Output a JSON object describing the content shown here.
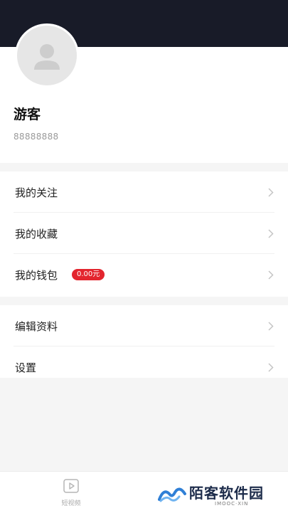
{
  "profile": {
    "name": "游客",
    "id": "88888888",
    "avatar_icon": "user-placeholder-icon"
  },
  "menu_groups": [
    {
      "items": [
        {
          "label": "我的关注",
          "icon": "chevron-right-icon"
        },
        {
          "label": "我的收藏",
          "icon": "chevron-right-icon"
        },
        {
          "label": "我的钱包",
          "badge": "0.00元",
          "icon": "chevron-right-icon"
        }
      ]
    },
    {
      "items": [
        {
          "label": "编辑资料",
          "icon": "chevron-right-icon"
        },
        {
          "label": "设置",
          "icon": "chevron-right-icon"
        }
      ]
    }
  ],
  "tabbar": {
    "tabs": [
      {
        "label": "短视频",
        "icon": "play-video-icon"
      }
    ]
  },
  "watermark": {
    "name": "陌客软件园",
    "sub": "IMOOC·XIN"
  },
  "colors": {
    "header": "#181b28",
    "badge": "#e3252e",
    "background": "#f5f5f5"
  }
}
